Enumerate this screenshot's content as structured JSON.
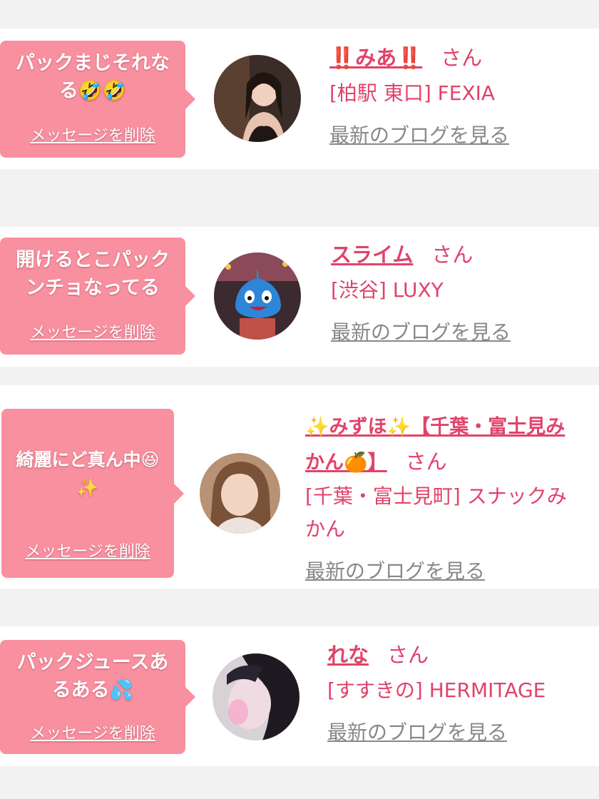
{
  "delete_label": "メッセージを削除",
  "blog_label": "最新のブログを見る",
  "honorific": "さん",
  "colors": {
    "bubble": "#f8909f",
    "accent": "#e0436a",
    "link_gray": "#888888",
    "background": "#f2f2f2"
  },
  "messages": [
    {
      "text_line1": "パックまじそれな",
      "text_line2": "る🤣🤣",
      "name": "‼️みあ‼️",
      "shop": "[柏駅 東口] FEXIA"
    },
    {
      "text_line1": "開けるとこパック",
      "text_line2": "ンチョなってる",
      "name": "スライム",
      "shop": "[渋谷] LUXY"
    },
    {
      "text_line1": "綺麗にど真ん中😆",
      "text_line2": "✨",
      "name_line1": "✨みずほ✨【千葉・富士見み",
      "name_line2": "かん🍊】",
      "shop_line1": "[千葉・富士見町] スナックみ",
      "shop_line2": "かん"
    },
    {
      "text_line1": "パックジュースあ",
      "text_line2": "るある💦",
      "name": "れな",
      "shop": "[すすきの] HERMITAGE"
    }
  ]
}
